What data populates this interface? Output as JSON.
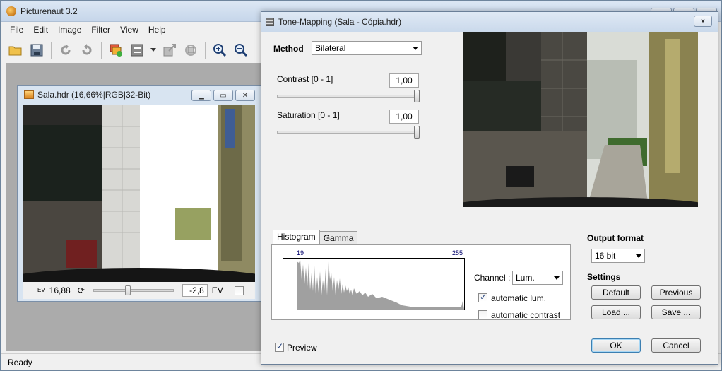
{
  "app": {
    "title": "Picturenaut 3.2",
    "menu": [
      "File",
      "Edit",
      "Image",
      "Filter",
      "View",
      "Help"
    ],
    "status": "Ready"
  },
  "image_window": {
    "title": "Sala.hdr (16,66%|RGB|32-Bit)",
    "ev_label": "EV",
    "ev_value": "16,88",
    "exposure_value": "-2,8",
    "exposure_unit": "EV"
  },
  "dialog": {
    "title": "Tone-Mapping (Sala - Cópia.hdr)",
    "close_symbol": "x",
    "method_label": "Method",
    "method_value": "Bilateral",
    "contrast_label": "Contrast [0 - 1]",
    "contrast_value": "1,00",
    "saturation_label": "Saturation [0 - 1]",
    "saturation_value": "1,00",
    "tabs": [
      "Histogram",
      "Gamma"
    ],
    "hist_min": "19",
    "hist_max": "255",
    "channel_label": "Channel :",
    "channel_value": "Lum.",
    "auto_lum_label": "automatic lum.",
    "auto_lum_checked": true,
    "auto_contrast_label": "automatic contrast",
    "auto_contrast_checked": false,
    "output_format_label": "Output format",
    "output_format_value": "16 bit",
    "settings_label": "Settings",
    "buttons": {
      "default": "Default",
      "previous": "Previous",
      "load": "Load ...",
      "save": "Save ...",
      "ok": "OK",
      "cancel": "Cancel"
    },
    "preview_label": "Preview",
    "preview_checked": true
  },
  "colors": {
    "histogram_fill": "#a0a0a0",
    "titlebar": "#cad9eb",
    "workspace": "#ababab"
  }
}
